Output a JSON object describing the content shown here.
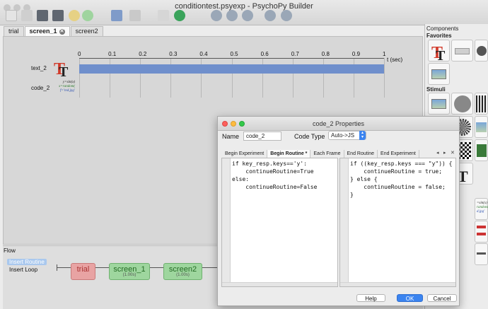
{
  "window": {
    "title": "conditiontest.psyexp - PsychoPy Builder"
  },
  "toolbar": {
    "icons": [
      "new-file-icon",
      "open-icon",
      "save-icon",
      "save-as-icon",
      "undo-icon",
      "redo-icon",
      "monitor-icon",
      "settings-icon",
      "compile-icon",
      "run-icon",
      "stop-icon",
      "globe-icon",
      "globe-icon",
      "globe-icon",
      "globe-icon"
    ]
  },
  "tabs": [
    {
      "label": "trial",
      "active": false
    },
    {
      "label": "screen_1",
      "active": true
    },
    {
      "label": "screen2",
      "active": false
    }
  ],
  "timeline": {
    "ticks": [
      "0",
      "0.1",
      "0.2",
      "0.3",
      "0.4",
      "0.5",
      "0.6",
      "0.7",
      "0.8",
      "0.9",
      "1"
    ],
    "unit": "t (sec)",
    "components": [
      {
        "name": "text_2",
        "icon": "text-component-icon"
      },
      {
        "name": "code_2",
        "icon": "code-component-icon"
      }
    ],
    "code_icon_text": [
      "y=sin(x)",
      "x=random(",
      "f='red.jpg'"
    ]
  },
  "components_panel": {
    "title": "Components",
    "sections": [
      "Favorites",
      "Stimuli"
    ],
    "code_icon_text": [
      "=sin(x)",
      "random(",
      "d.jpg'"
    ]
  },
  "flow": {
    "header": "Flow",
    "insert_routine": "Insert Routine",
    "insert_loop": "Insert Loop",
    "routines": [
      {
        "label": "trial",
        "duration": "",
        "color": "#e8a3a3"
      },
      {
        "label": "screen_1",
        "duration": "(1.00s)",
        "color": "#9ed69e"
      },
      {
        "label": "screen2",
        "duration": "(1.00s)",
        "color": "#9ed69e"
      }
    ]
  },
  "dialog": {
    "title": "code_2 Properties",
    "name_label": "Name",
    "name_value": "code_2",
    "code_type_label": "Code Type",
    "code_type_value": "Auto->JS",
    "code_tabs": [
      {
        "label": "Begin Experiment",
        "active": false
      },
      {
        "label": "Begin Routine *",
        "active": true
      },
      {
        "label": "Each Frame",
        "active": false
      },
      {
        "label": "End Routine",
        "active": false
      },
      {
        "label": "End Experiment",
        "active": false
      }
    ],
    "tab_nav": [
      "◂",
      "▸",
      "✕"
    ],
    "python_code": "if key_resp.keys=='y':\n    continueRoutine=True\nelse:\n    continueRoutine=False",
    "js_code": "if ((key_resp.keys === \"y\")) {\n    continueRoutine = true;\n} else {\n    continueRoutine = false;\n}",
    "buttons": {
      "help": "Help",
      "ok": "OK",
      "cancel": "Cancel"
    }
  }
}
